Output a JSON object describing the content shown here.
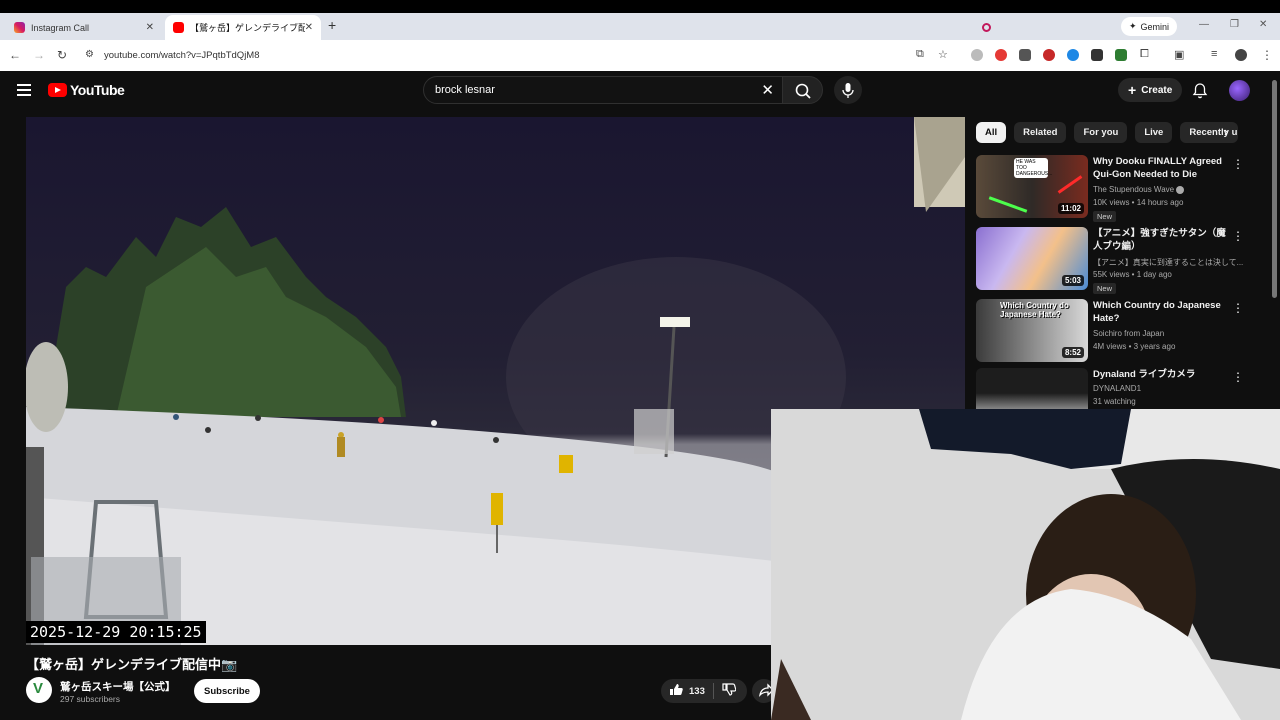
{
  "browser": {
    "tabs": [
      {
        "label": "Instagram Call",
        "active": false
      },
      {
        "label": "【鷲ヶ岳】ゲレンデライブ配信中📷",
        "active": true
      }
    ],
    "new_tab_label": "+",
    "gemini_label": "Gemini",
    "url": "youtube.com/watch?v=JPqtbTdQjM8"
  },
  "youtube": {
    "logo_text": "YouTube",
    "search_query": "brock lesnar",
    "create_label": "Create",
    "video": {
      "timestamp_overlay": "2025-12-29 20:15:25",
      "title": "【鷲ヶ岳】ゲレンデライブ配信中📷",
      "channel_name": "鷲ヶ岳スキー場【公式】",
      "subscribers": "297 subscribers",
      "subscribe_label": "Subscribe",
      "like_count": "133"
    },
    "chips": [
      "All",
      "Related",
      "For you",
      "Live",
      "Recently up"
    ],
    "recommendations": [
      {
        "title": "Why Dooku FINALLY Agreed Qui-Gon Needed to Die",
        "channel": "The Stupendous Wave",
        "meta": "10K views • 14 hours ago",
        "duration": "11:02",
        "badge": "New",
        "thumb_text": "HE WAS TOO DANGEROUS..."
      },
      {
        "title": "【アニメ】強すぎたサタン（魔人ブウ編）",
        "channel": "【アニメ】真実に到達することは決して...",
        "meta": "55K views • 1 day ago",
        "duration": "5:03",
        "badge": "New"
      },
      {
        "title": "Which Country do Japanese Hate?",
        "channel": "Soichiro from Japan",
        "meta": "4M views • 3 years ago",
        "duration": "8:52",
        "thumb_text": "Which Country do Japanese Hate?"
      },
      {
        "title": "Dynaland ライブカメラ",
        "channel": "DYNALAND1",
        "meta": "31 watching"
      }
    ]
  },
  "colors": {
    "brand_red": "#ff0000",
    "bg": "#0f0f0f",
    "chip_bg": "#272727"
  }
}
